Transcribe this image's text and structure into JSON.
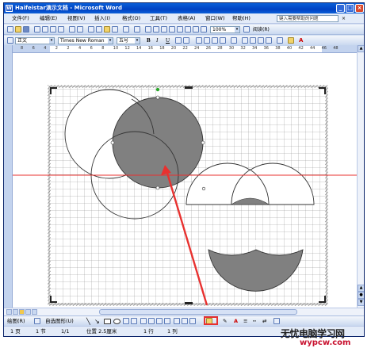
{
  "window": {
    "title": "Haifeistar演示文档 - Microsoft Word",
    "minimize": "_",
    "maximize": "□",
    "close": "×"
  },
  "menubar": {
    "items": [
      "文件(F)",
      "编辑(E)",
      "视图(V)",
      "插入(I)",
      "格式(O)",
      "工具(T)",
      "表格(A)",
      "窗口(W)",
      "帮助(H)"
    ],
    "help_placeholder": "键入需要帮助的问题"
  },
  "standard_toolbar": {
    "zoom": "100%",
    "reading_label": "阅读(R)"
  },
  "formatting_toolbar": {
    "style": "正文",
    "font": "Times New Roman",
    "size": "五号",
    "bold": "B",
    "italic": "I",
    "underline": "U",
    "font_color_label": "A"
  },
  "ruler": {
    "marks": [
      "8",
      "6",
      "4",
      "2",
      "2",
      "4",
      "6",
      "8",
      "10",
      "12",
      "14",
      "16",
      "18",
      "20",
      "22",
      "24",
      "26",
      "28",
      "30",
      "32",
      "34",
      "36",
      "38",
      "40",
      "42",
      "44",
      "46",
      "48"
    ]
  },
  "drawing_toolbar": {
    "draw_label": "绘图(R)",
    "autoshape_label": "自选图形(U)"
  },
  "statusbar": {
    "page": "1 页",
    "section": "1 节",
    "page_of": "1/1",
    "position": "位置 2.5厘米",
    "line": "1 行",
    "column": "1 列"
  },
  "watermark": {
    "line1": "无忧电脑学习网",
    "line2": "wypcw.com"
  },
  "colors": {
    "title_blue": "#0041c2",
    "shape_fill": "#808080",
    "guide_red": "#e8312f",
    "anchor_green": "#2aa52a"
  }
}
